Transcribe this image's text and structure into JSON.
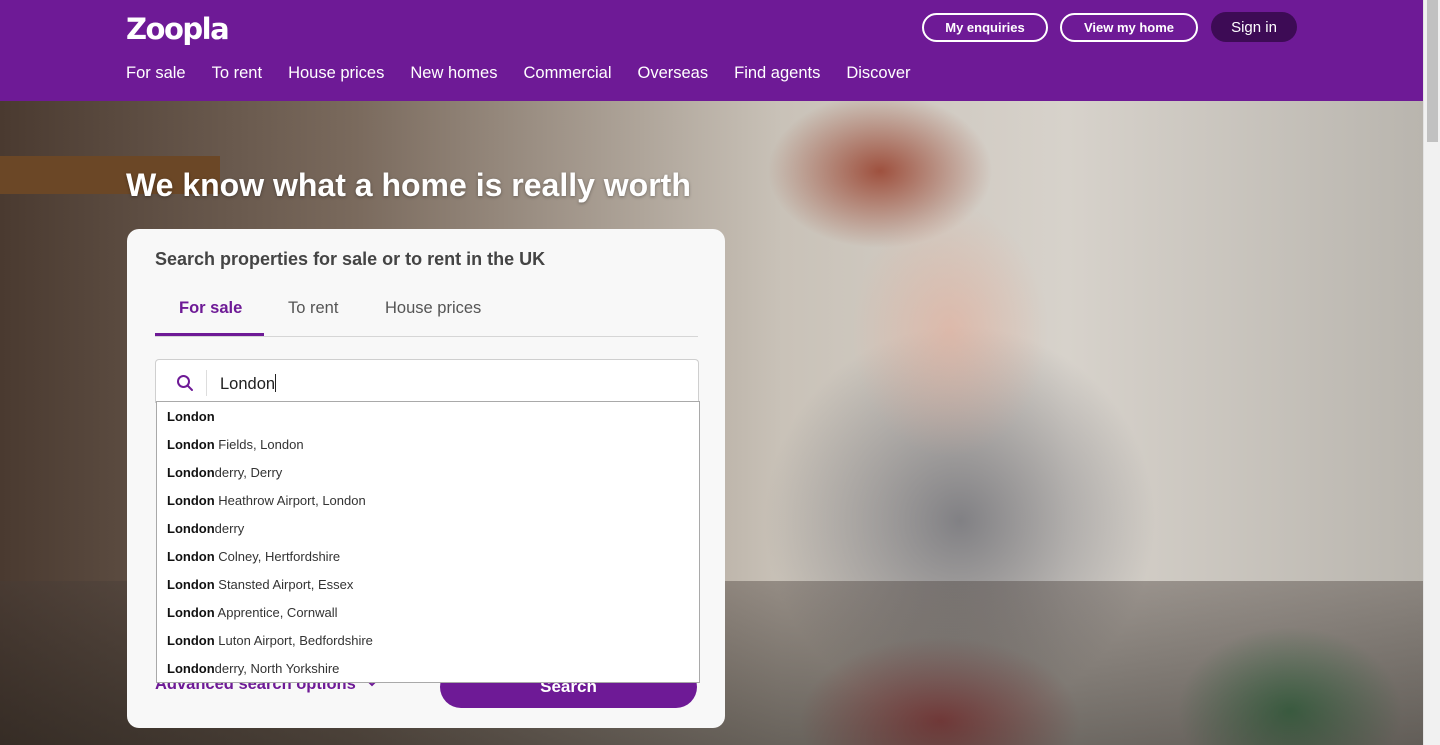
{
  "brand": {
    "logo_text": "Zoopla",
    "accent": "#6e1a96"
  },
  "header": {
    "enquiries_label": "My enquiries",
    "view_home_label": "View my home",
    "signin_label": "Sign in",
    "nav": [
      "For sale",
      "To rent",
      "House prices",
      "New homes",
      "Commercial",
      "Overseas",
      "Find agents",
      "Discover"
    ]
  },
  "hero": {
    "title": "We know what a home is really worth"
  },
  "search": {
    "title": "Search properties for sale or to rent in the UK",
    "tabs": [
      "For sale",
      "To rent",
      "House prices"
    ],
    "active_tab": "For sale",
    "input_value": "London",
    "search_icon": "search-icon",
    "advanced_label": "Advanced search options",
    "chevron_icon": "chevron-down-icon",
    "button_label": "Search"
  },
  "suggestions": [
    {
      "match": "London",
      "rest": ""
    },
    {
      "match": "London",
      "rest": " Fields, London"
    },
    {
      "match": "London",
      "rest": "derry, Derry"
    },
    {
      "match": "London",
      "rest": " Heathrow Airport, London"
    },
    {
      "match": "London",
      "rest": "derry"
    },
    {
      "match": "London",
      "rest": " Colney, Hertfordshire"
    },
    {
      "match": "London",
      "rest": " Stansted Airport, Essex"
    },
    {
      "match": "London",
      "rest": " Apprentice, Cornwall"
    },
    {
      "match": "London",
      "rest": " Luton Airport, Bedfordshire"
    },
    {
      "match": "London",
      "rest": "derry, North Yorkshire"
    }
  ]
}
